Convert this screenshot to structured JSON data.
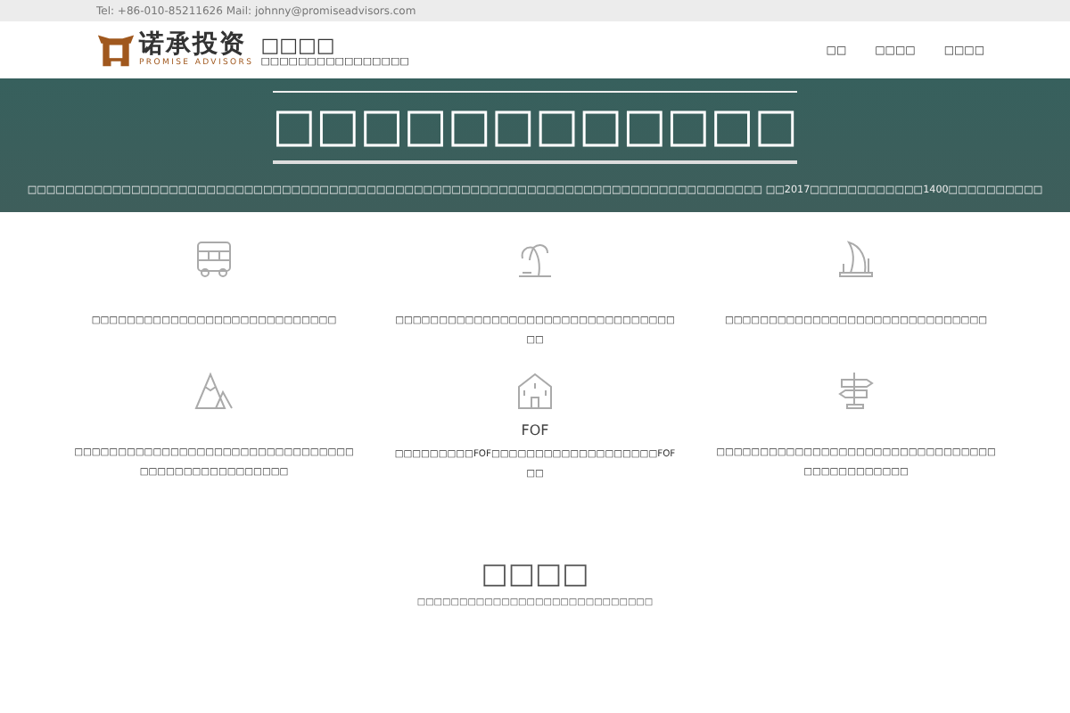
{
  "topbar": {
    "contact": "Tel: +86-010-85211626 Mail: johnny@promiseadvisors.com"
  },
  "header": {
    "logo_text": "诺承投资",
    "logo_subtext": "PROMISE ADVISORS",
    "site_name": "□□□□",
    "tagline": "□□□□□□□□□□□□□□□□",
    "nav": [
      {
        "label": "□□"
      },
      {
        "label": "□□□□"
      },
      {
        "label": "□□□□"
      }
    ]
  },
  "hero": {
    "title": "□□□□□□□□□□□□",
    "text": "□□□□□□□□□□□□□□□□□□□□□□□□□□□□□□□□□□□□□□□□□□□□□□□□□□□□□□□□□□□□□□□□□□□□□□□□□□□□□□ □□2017□□□□□□□□□□□□1400□□□□□□□□□□"
  },
  "features": [
    {
      "kind": "bus",
      "text": "□□□□□□□□□□□□□□□□□□□□□□□□□□□□"
    },
    {
      "kind": "palm",
      "text": "□□□□□□□□□□□□□□□□□□□□□□□□□□□□□□□□□□"
    },
    {
      "kind": "sail",
      "text": "□□□□□□□□□□□□□□□□□□□□□□□□□□□□□□"
    },
    {
      "kind": "mountain",
      "text": "□□□□□□□□□□□□□□□□□□□□□□□□□□□□□□□□□□□□□□□□□□□□□□□□□"
    },
    {
      "kind": "building",
      "title": "FOF",
      "text": "□□□□□□□□□FOF□□□□□□□□□□□□□□□□□□□FOF□□"
    },
    {
      "kind": "signpost",
      "text": "□□□□□□□□□□□□□□□□□□□□□□□□□□□□□□□□□□□□□□□□□□□□"
    }
  ],
  "section": {
    "title": "□□□□",
    "subtitle": "□□□□□□□□□□□□□□□□□□□□□□□□□□□□"
  }
}
